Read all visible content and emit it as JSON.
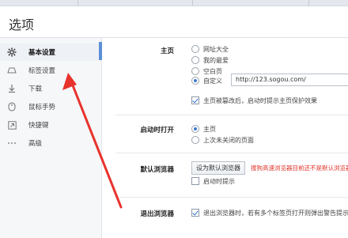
{
  "window": {
    "title": "选项"
  },
  "sidebar": {
    "items": [
      {
        "label": "基本设置",
        "icon": "gear-icon",
        "active": true
      },
      {
        "label": "标签设置",
        "icon": "tab-icon",
        "active": false
      },
      {
        "label": "下载",
        "icon": "download-icon",
        "active": false
      },
      {
        "label": "鼠标手势",
        "icon": "mouse-icon",
        "active": false
      },
      {
        "label": "快捷键",
        "icon": "shortcut-icon",
        "active": false
      },
      {
        "label": "高级",
        "icon": "more-icon",
        "active": false
      }
    ]
  },
  "homepage": {
    "label": "主页",
    "options": [
      {
        "label": "网址大全",
        "checked": false
      },
      {
        "label": "我的最爱",
        "checked": false
      },
      {
        "label": "空白页",
        "checked": false
      },
      {
        "label": "自定义",
        "checked": true
      }
    ],
    "url_value": "http://123.sogou.com/",
    "protect_checkbox": {
      "label": "主页被篡改后，启动时提示主页保护效果",
      "checked": true
    }
  },
  "startup": {
    "label": "启动时打开",
    "options": [
      {
        "label": "主页",
        "checked": true
      },
      {
        "label": "上次未关闭的页面",
        "checked": false
      }
    ]
  },
  "default_browser": {
    "label": "默认浏览器",
    "button_label": "设为默认浏览器",
    "warning": "搜狗高速浏览器目前还不是默认浏览器",
    "startup_prompt": {
      "label": "启动时提示",
      "checked": false
    }
  },
  "exit_browser": {
    "label": "退出浏览器",
    "warn_checkbox": {
      "label": "退出浏览器时，若有多个标签页打开则弹出警告提示",
      "checked": true
    }
  },
  "colors": {
    "accent": "#3c78d8",
    "arrow": "#e8322c",
    "warning": "#e0352b"
  }
}
